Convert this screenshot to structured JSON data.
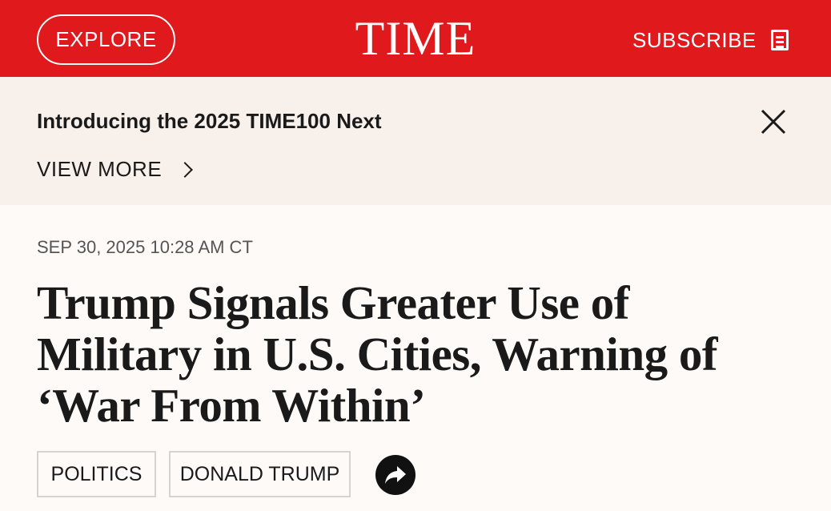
{
  "header": {
    "explore_label": "EXPLORE",
    "logo_text": "TIME",
    "subscribe_label": "SUBSCRIBE",
    "brand_color": "#e0191d"
  },
  "promo": {
    "title": "Introducing the 2025 TIME100 Next",
    "view_more_label": "VIEW MORE",
    "close_icon": "close-icon"
  },
  "article": {
    "dateline": "SEP 30, 2025 10:28 AM CT",
    "headline": "Trump Signals Greater Use of Military in U.S. Cities, Warning of ‘War From Within’",
    "tags": [
      "POLITICS",
      "DONALD TRUMP"
    ],
    "share_icon": "share-icon"
  }
}
